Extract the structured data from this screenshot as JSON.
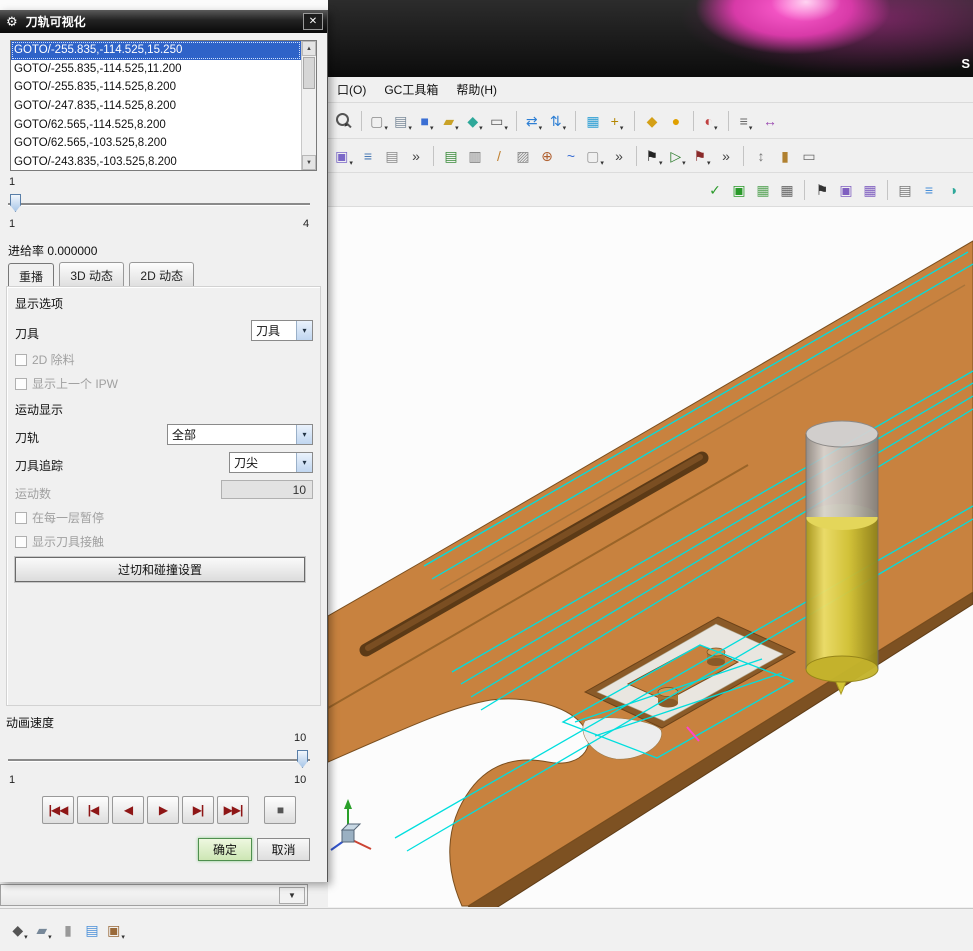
{
  "colors": {
    "accent_blue": "#2f63c8",
    "plate_orange": "#c8823f",
    "toolpath_cyan": "#00dede",
    "tool_yellow": "#d6c83e",
    "tool_gray": "#c2c2c2",
    "play_red": "#8e1616",
    "ok_green": "#4f8f4f"
  },
  "titlebar": {
    "brand": "S"
  },
  "strip": {
    "chevron": "▼"
  },
  "menubar": {
    "items": [
      {
        "name": "menu-item-window",
        "label": "口(O)"
      },
      {
        "name": "menu-item-gc-toolbox",
        "label": "GC工具箱"
      },
      {
        "name": "menu-item-help",
        "label": "帮助(H)"
      }
    ]
  },
  "toolbars": {
    "row1": [
      {
        "name": "search-icon",
        "shape": "magnifier",
        "dd": true
      },
      {
        "type": "sep"
      },
      {
        "name": "selection-filter-icon",
        "glyph": "▢",
        "color": "#8a8a8a",
        "dd": true
      },
      {
        "name": "layers-icon",
        "glyph": "▤",
        "color": "#7a8a99",
        "dd": true
      },
      {
        "name": "solid-body-icon",
        "glyph": "■",
        "color": "#3b6fd4",
        "dd": true
      },
      {
        "name": "sheet-body-icon",
        "glyph": "▰",
        "color": "#c9a227",
        "dd": true
      },
      {
        "name": "datum-icon",
        "glyph": "◆",
        "color": "#2ea89a",
        "dd": true
      },
      {
        "name": "sketch-icon",
        "glyph": "▭",
        "color": "#5a5a5a",
        "dd": true
      },
      {
        "type": "sep"
      },
      {
        "name": "move-object-icon",
        "glyph": "⇄",
        "color": "#2e7fd4",
        "dd": true
      },
      {
        "name": "pattern-icon",
        "glyph": "⇅",
        "color": "#2e7fd4",
        "dd": true
      },
      {
        "type": "sep"
      },
      {
        "name": "expressions-icon",
        "glyph": "▦",
        "color": "#2e9fd4"
      },
      {
        "name": "csys-icon",
        "glyph": "+",
        "color": "#b38600",
        "dd": true
      },
      {
        "type": "sep"
      },
      {
        "name": "tools-icon",
        "glyph": "◆",
        "color": "#d4a017"
      },
      {
        "name": "key-icon",
        "glyph": "●",
        "color": "#e0a000"
      },
      {
        "type": "sep"
      },
      {
        "name": "role-icon",
        "glyph": "◐",
        "color": "#c04040",
        "dd": true
      },
      {
        "type": "sep"
      },
      {
        "name": "snap-point-icon",
        "glyph": "≡",
        "color": "#6a6a6a",
        "dd": true
      },
      {
        "name": "measure-icon",
        "glyph": "↔",
        "color": "#9a4ab0"
      }
    ],
    "row2": [
      {
        "name": "view-group-icon",
        "glyph": "▣",
        "color": "#7b68c8",
        "dd": true
      },
      {
        "name": "part-navigator-icon",
        "glyph": "≡",
        "color": "#4a7ab5"
      },
      {
        "name": "information-icon",
        "glyph": "▤",
        "color": "#8a8a8a"
      },
      {
        "name": "overflow-icon",
        "glyph": "»",
        "color": "#444444"
      },
      {
        "type": "sep"
      },
      {
        "name": "operation-list-icon",
        "glyph": "▤",
        "color": "#3b8c3b"
      },
      {
        "name": "program-order-icon",
        "glyph": "▥",
        "color": "#777777"
      },
      {
        "name": "line-icon",
        "glyph": "/",
        "color": "#c08030"
      },
      {
        "name": "section-icon",
        "glyph": "▨",
        "color": "#888888"
      },
      {
        "name": "point-icon",
        "glyph": "⊕",
        "color": "#b06030"
      },
      {
        "name": "spline-icon",
        "glyph": "~",
        "color": "#3b6fd4"
      },
      {
        "name": "more-curves-icon",
        "glyph": "▢",
        "color": "#999999",
        "dd": true
      },
      {
        "name": "overflow2-icon",
        "glyph": "»",
        "color": "#444444"
      },
      {
        "type": "sep"
      },
      {
        "name": "generate-toolpath-icon",
        "glyph": "⚑",
        "color": "#222222",
        "dd": true
      },
      {
        "name": "verify-toolpath-icon",
        "glyph": "▷",
        "color": "#2a7a2a",
        "dd": true
      },
      {
        "name": "postprocess-icon",
        "glyph": "⚑",
        "color": "#8a2a2a",
        "dd": true
      },
      {
        "name": "overflow3-icon",
        "glyph": "»",
        "color": "#444444"
      },
      {
        "type": "sep"
      },
      {
        "name": "list-tools-icon",
        "glyph": "↕",
        "color": "#777777"
      },
      {
        "name": "workpiece-icon",
        "glyph": "▮",
        "color": "#b08030"
      },
      {
        "name": "machine-icon",
        "glyph": "▭",
        "color": "#6a6a6a"
      }
    ],
    "row3": [
      {
        "name": "verify-icon",
        "glyph": "✓",
        "color": "#2a9a2a"
      },
      {
        "name": "simulate-icon",
        "glyph": "▣",
        "color": "#2a9a2a"
      },
      {
        "name": "gouge-check-icon",
        "glyph": "▦",
        "color": "#5aa55a"
      },
      {
        "name": "grid-icon",
        "glyph": "▦",
        "color": "#666666"
      },
      {
        "type": "sep"
      },
      {
        "name": "flag-icon",
        "glyph": "⚑",
        "color": "#333333"
      },
      {
        "name": "shop-doc-icon",
        "glyph": "▣",
        "color": "#8060c0"
      },
      {
        "name": "report-icon",
        "glyph": "▦",
        "color": "#8060c0"
      },
      {
        "type": "sep"
      },
      {
        "name": "layout-icon",
        "glyph": "▤",
        "color": "#777777"
      },
      {
        "name": "sync-icon",
        "glyph": "≡",
        "color": "#4a90d9"
      },
      {
        "name": "display-icon",
        "glyph": "◑",
        "color": "#2ea89a"
      }
    ],
    "bottom": [
      {
        "name": "section-view-icon",
        "glyph": "◆",
        "color": "#555555",
        "dd": true
      },
      {
        "name": "clip-section-icon",
        "glyph": "▰",
        "color": "#778899",
        "dd": true
      },
      {
        "name": "small-block-icon",
        "glyph": "▮",
        "color": "#999999"
      },
      {
        "name": "doc-icon",
        "glyph": "▤",
        "color": "#4a90d9"
      },
      {
        "name": "material-icon",
        "glyph": "▣",
        "color": "#9a6a3a",
        "dd": true
      }
    ]
  },
  "dialog": {
    "gear_glyph": "⚙",
    "title": "刀轨可视化",
    "close_glyph": "✕",
    "goto_list": [
      "GOTO/-255.835,-114.525,15.250",
      "GOTO/-255.835,-114.525,11.200",
      "GOTO/-255.835,-114.525,8.200",
      "GOTO/-247.835,-114.525,8.200",
      "GOTO/62.565,-114.525,8.200",
      "GOTO/62.565,-103.525,8.200",
      "GOTO/-243.835,-103.525,8.200"
    ],
    "position_slider": {
      "current": "1",
      "min": "1",
      "max": "4"
    },
    "feed_rate_label": "进给率 0.000000",
    "tabs": [
      {
        "label": "重播"
      },
      {
        "label": "3D 动态"
      },
      {
        "label": "2D 动态"
      }
    ],
    "display_options_label": "显示选项",
    "tool_label": "刀具",
    "tool_combo_value": "刀具",
    "cb_2d_material": "2D 除料",
    "cb_show_ipw": "显示上一个 IPW",
    "motion_display_label": "运动显示",
    "toolpath_label": "刀轨",
    "toolpath_combo_value": "全部",
    "tool_trace_label": "刀具追踪",
    "tool_trace_combo_value": "刀尖",
    "motion_count_label": "运动数",
    "motion_count_value": "10",
    "cb_pause_each_layer": "在每一层暂停",
    "cb_show_contact": "显示刀具接触",
    "collision_settings_button": "过切和碰撞设置",
    "animation_speed_label": "动画速度",
    "speed_slider": {
      "current": "10",
      "min": "1",
      "max": "10"
    },
    "playback": [
      {
        "name": "play-to-start-button",
        "glyph": "|◀◀"
      },
      {
        "name": "step-back-button",
        "glyph": "|◀"
      },
      {
        "name": "play-reverse-button",
        "glyph": "◀"
      },
      {
        "name": "play-button",
        "glyph": "▶"
      },
      {
        "name": "step-forward-button",
        "glyph": "▶|"
      },
      {
        "name": "play-to-end-button",
        "glyph": "▶▶|"
      },
      {
        "type": "gap"
      },
      {
        "name": "stop-button",
        "glyph": "■",
        "color": "#555555"
      }
    ],
    "ok_button": "确定",
    "cancel_button": "取消"
  }
}
